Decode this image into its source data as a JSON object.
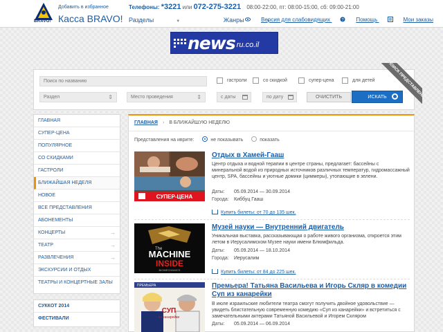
{
  "header": {
    "logo_word": "BRAVO!",
    "add_favorites": "Добавить в избранное",
    "brand": "Касса BRAVO!",
    "phones_label": "Телефоны:",
    "phone_short": "*3221",
    "phone_or": "или",
    "phone_long": "072-275-3221",
    "hours": "08:00-22:00, пт: 08:00-15:00, сб: 09:00-21:00",
    "nav": [
      "Разделы",
      "Жанры"
    ],
    "links": [
      "Версия для слабовидящих",
      "Помощь",
      "Мои заказы"
    ]
  },
  "banner": {
    "word": "news",
    "domain": "ru.co.il"
  },
  "search": {
    "name_placeholder": "Поиск по названию",
    "checkboxes": [
      "гастроли",
      "со скидкой",
      "супер-цена",
      "для детей"
    ],
    "section": "Раздел",
    "venue": "Место проведения",
    "date_from": "с даты",
    "date_to": "по дату",
    "clear": "ОЧИСТИТЬ",
    "submit": "ИСКАТЬ",
    "ribbon": "ПОИСК ПРЕДСТАВЛЕНИЯ"
  },
  "sidebar": {
    "items": [
      "ГЛАВНАЯ",
      "СУПЕР-ЦЕНА",
      "ПОПУЛЯРНОЕ",
      "СО СКИДКАМИ",
      "ГАСТРОЛИ",
      "БЛИЖАЙШАЯ НЕДЕЛЯ",
      "НОВОЕ",
      "ВСЕ ПРЕДСТАВЛЕНИЯ",
      "АБОНЕМЕНТЫ",
      "КОНЦЕРТЫ",
      "ТЕАТР",
      "РАЗВЛЕЧЕНИЯ",
      "ЭКСКУРСИИ И ОТДЫХ",
      "ТЕАТРЫ И КОНЦЕРТНЫЕ ЗАЛЫ"
    ],
    "extra": [
      "СУККОТ 2014",
      "ФЕСТИВАЛИ"
    ]
  },
  "main": {
    "breadcrumb_home": "ГЛАВНАЯ",
    "breadcrumb_current": "В БЛИЖАЙШУЮ НЕДЕЛЮ",
    "filter_label": "Представления на иврите:",
    "filter_hide": "не показывать",
    "filter_show": "показать",
    "dates_label": "Даты:",
    "city_label": "Города:",
    "events": [
      {
        "title": "Отдых в Хамей-Гааш",
        "desc": "Центр отдыха и водной терапии в центре страны, предлагает: бассейны с минеральной водой из природных источников различных температур, гидромассажный центр, SPA, бассейны и уютные домики (циммеры), утопающие в зелени.",
        "dates": "05.09.2014 — 30.09.2014",
        "city": "Киббуц Гааш",
        "buy": "Купить билеты: от 70 до 135 шек.",
        "badge": "СУПЕР-ЦЕНА"
      },
      {
        "title": "Музей науки — Внутренний двигатель",
        "desc": "Уникальная выставка, рассказывающая о работе живого организма, откроется этим летом в Иерусалимском Музее науки имени Блюмфильда.",
        "dates": "05.09.2014 — 18.10.2014",
        "city": "Иерусалим",
        "buy": "Купить билеты: от 84 до 225 шек.",
        "img_line1": "The",
        "img_line2": "MACHINE",
        "img_line3": "INSIDE",
        "img_line4": "BIOMECHANICS"
      },
      {
        "title": "Премьера! Татьяна Васильева и Игорь Скляр в комедии Суп из канарейки",
        "desc": "В июле израильские любители театра смогут получить двойное удовольствие — увидеть блистательную современную комедию «Суп из канарейки» и встретиться с замечательными актерами Татьяной Васильевой и Игорем Скляром",
        "dates": "05.09.2014 — 06.09.2014",
        "img_top": "ПРЕМЬЕРА",
        "img_title1": "СУП",
        "img_title2": "из канарейки"
      }
    ]
  },
  "colors": {
    "accent": "#f19000",
    "link": "#1a5ea8",
    "button": "#1b6ec2",
    "badge": "#e0141e"
  }
}
